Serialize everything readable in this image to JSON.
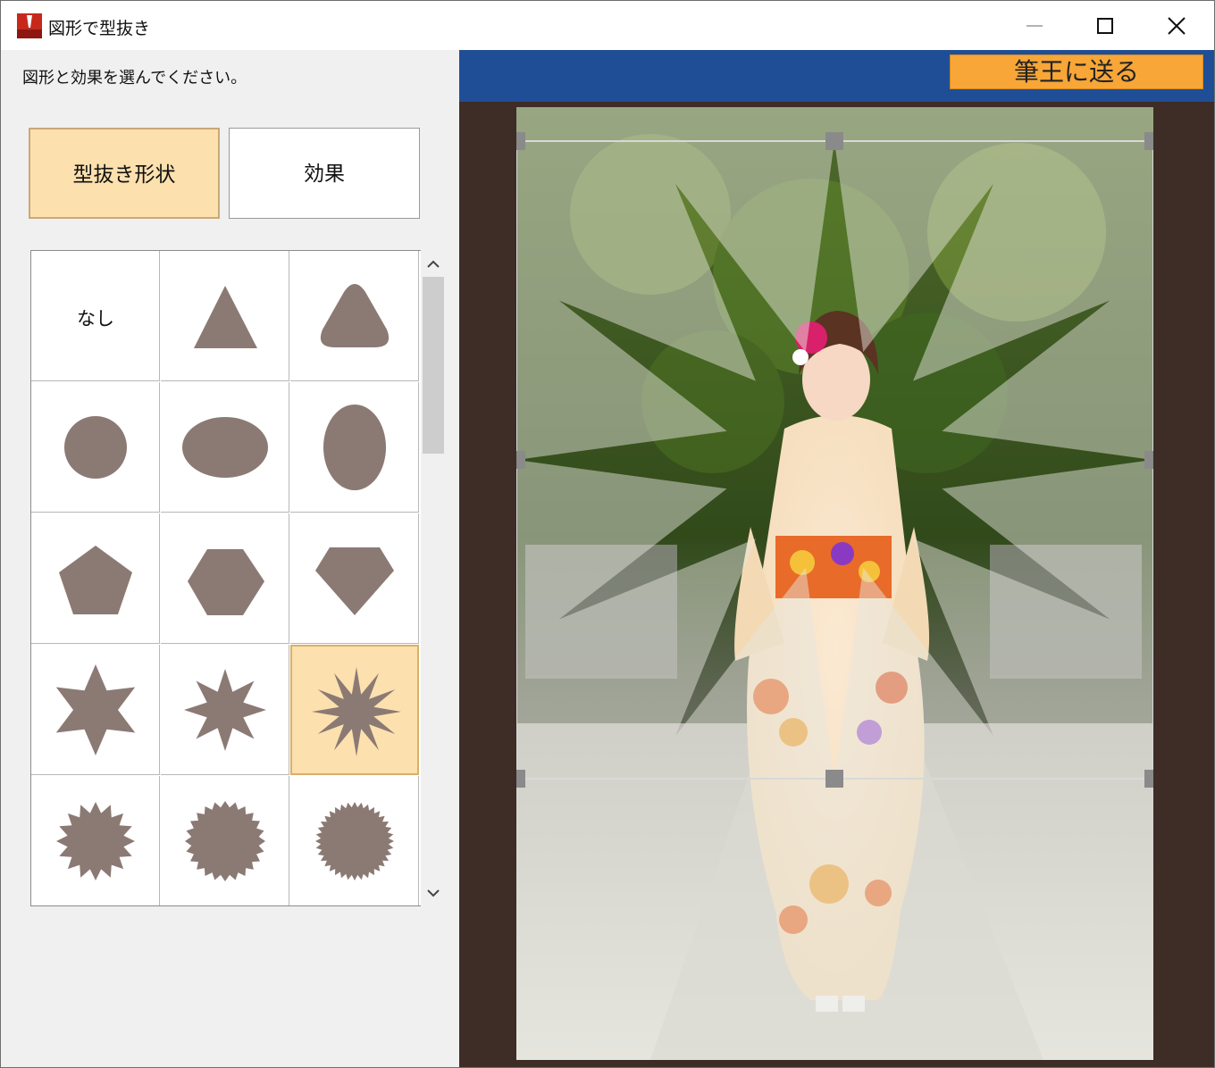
{
  "window": {
    "title": "図形で型抜き",
    "controls": [
      "minimize-icon",
      "maximize-icon",
      "close-icon"
    ]
  },
  "left_panel": {
    "instruction": "図形と効果を選んでください。",
    "tabs": [
      {
        "label": "型抜き形状",
        "active": true
      },
      {
        "label": "効果",
        "active": false
      }
    ],
    "shapes": [
      {
        "name": "none",
        "label": "なし"
      },
      {
        "name": "triangle"
      },
      {
        "name": "rounded-triangle"
      },
      {
        "name": "circle"
      },
      {
        "name": "horizontal-ellipse"
      },
      {
        "name": "vertical-ellipse"
      },
      {
        "name": "pentagon"
      },
      {
        "name": "hexagon"
      },
      {
        "name": "diamond-gem"
      },
      {
        "name": "star-6"
      },
      {
        "name": "star-8"
      },
      {
        "name": "star-12",
        "selected": true
      },
      {
        "name": "seal-16"
      },
      {
        "name": "seal-24"
      },
      {
        "name": "seal-36"
      }
    ],
    "shape_color": "#8b7a74",
    "selected_color": "#fce0ae"
  },
  "right_panel": {
    "send_button": "筆王に送る",
    "bar_color": "#1f4e96",
    "button_color": "#f7a637"
  }
}
